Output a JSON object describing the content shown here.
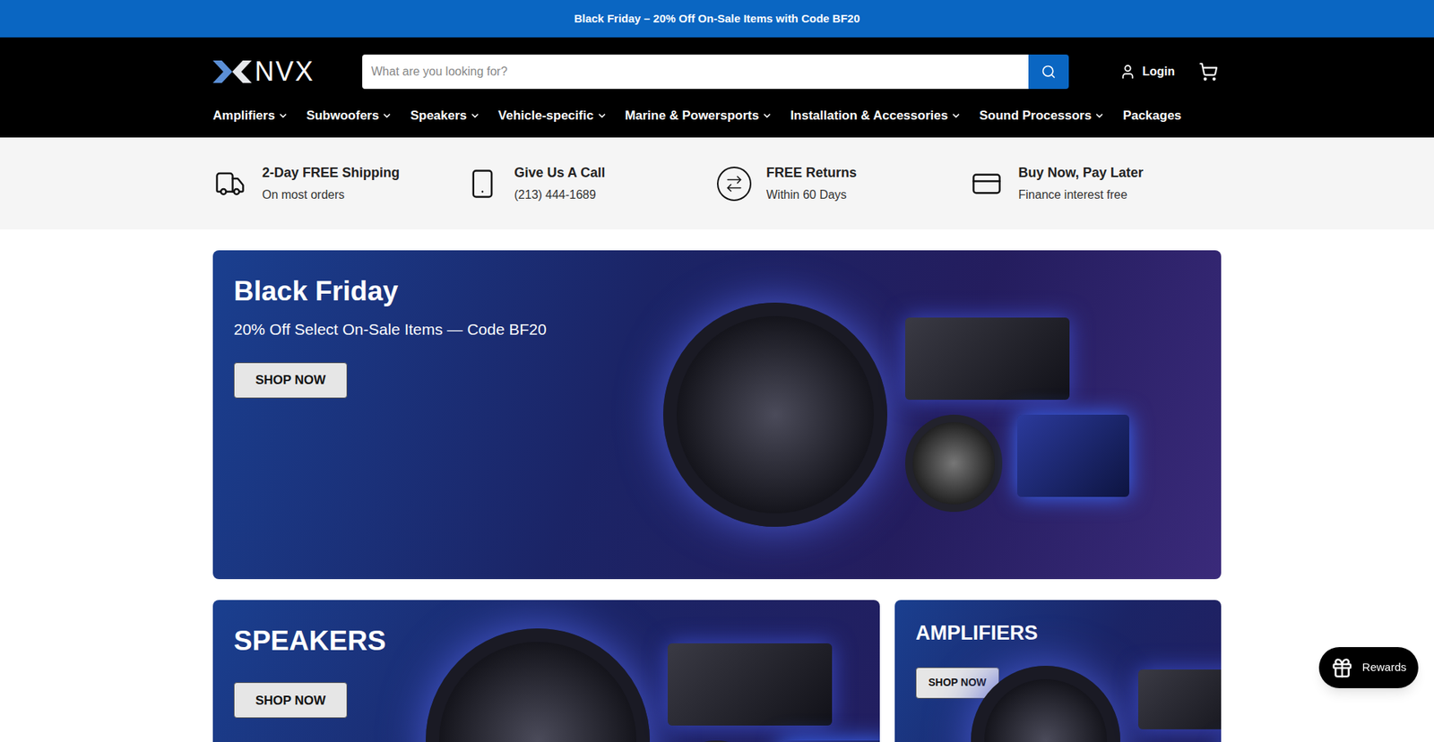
{
  "announcement": "Black Friday – 20% Off On-Sale Items with Code BF20",
  "header": {
    "logo": "NVX",
    "search": {
      "placeholder": "What are you looking for?"
    },
    "login": "Login"
  },
  "nav": [
    {
      "label": "Amplifiers",
      "has_menu": true
    },
    {
      "label": "Subwoofers",
      "has_menu": true
    },
    {
      "label": "Speakers",
      "has_menu": true
    },
    {
      "label": "Vehicle-specific",
      "has_menu": true
    },
    {
      "label": "Marine & Powersports",
      "has_menu": true
    },
    {
      "label": "Installation & Accessories",
      "has_menu": true
    },
    {
      "label": "Sound Processors",
      "has_menu": true
    },
    {
      "label": "Packages",
      "has_menu": false
    }
  ],
  "features": [
    {
      "kind": "shipping",
      "title": "2-Day FREE Shipping",
      "subtitle": "On most orders"
    },
    {
      "kind": "call",
      "title": "Give Us A Call",
      "subtitle": "(213) 444-1689"
    },
    {
      "kind": "returns",
      "title": "FREE Returns",
      "subtitle": "Within 60 Days"
    },
    {
      "kind": "finance",
      "title": "Buy Now, Pay Later",
      "subtitle": "Finance interest free"
    }
  ],
  "hero": {
    "title": "Black Friday",
    "subtitle": "20% Off Select On-Sale Items — Code BF20",
    "button": "SHOP NOW"
  },
  "categories": [
    {
      "title": "SPEAKERS",
      "button": "SHOP NOW",
      "size": "large"
    },
    {
      "title": "AMPLIFIERS",
      "button": "SHOP NOW",
      "size": "small"
    }
  ],
  "rewards": {
    "label": "Rewards"
  }
}
